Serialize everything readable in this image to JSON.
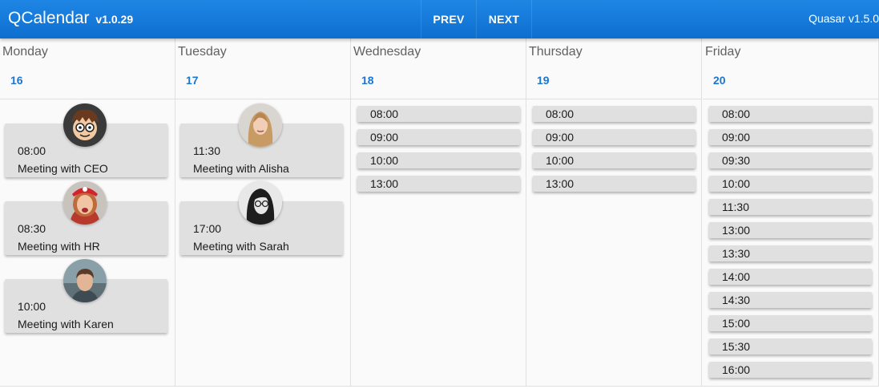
{
  "header": {
    "title": "QCalendar",
    "version": "v1.0.29",
    "prev_label": "PREV",
    "next_label": "NEXT",
    "quasar_version": "Quasar v1.5.0"
  },
  "days": [
    {
      "weekday": "Monday",
      "date": "16",
      "events": [
        {
          "time": "08:00",
          "title": "Meeting with CEO",
          "avatar": "cartoon-man-avatar"
        },
        {
          "time": "08:30",
          "title": "Meeting with HR",
          "avatar": "woman-red-hat-avatar"
        },
        {
          "time": "10:00",
          "title": "Meeting with Karen",
          "avatar": "young-man-avatar"
        }
      ]
    },
    {
      "weekday": "Tuesday",
      "date": "17",
      "events": [
        {
          "time": "11:30",
          "title": "Meeting with Alisha",
          "avatar": "woman-blonde-avatar"
        },
        {
          "time": "17:00",
          "title": "Meeting with Sarah",
          "avatar": "woman-glasses-avatar"
        }
      ]
    },
    {
      "weekday": "Wednesday",
      "date": "18",
      "slots": [
        "08:00",
        "09:00",
        "10:00",
        "13:00"
      ]
    },
    {
      "weekday": "Thursday",
      "date": "19",
      "slots": [
        "08:00",
        "09:00",
        "10:00",
        "13:00"
      ]
    },
    {
      "weekday": "Friday",
      "date": "20",
      "slots": [
        "08:00",
        "09:00",
        "09:30",
        "10:00",
        "11:30",
        "13:00",
        "13:30",
        "14:00",
        "14:30",
        "15:00",
        "15:30",
        "16:00"
      ]
    }
  ],
  "colors": {
    "toolbar": "#1976d2",
    "accent": "#1976d2",
    "event_bg": "#e0e0e0"
  }
}
